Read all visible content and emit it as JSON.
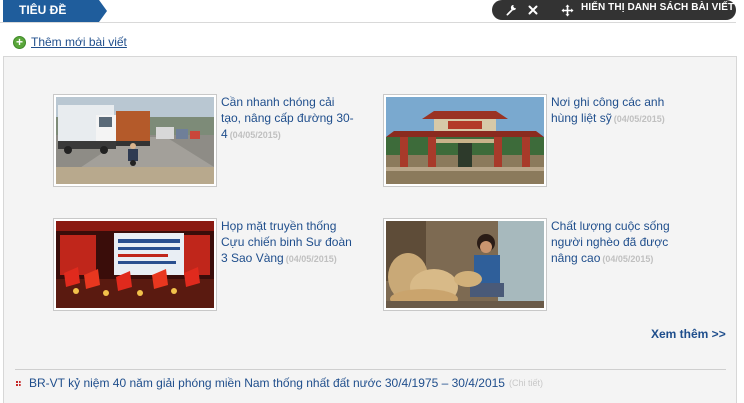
{
  "header": {
    "title": "TIÊU ĐỀ",
    "admin_list_label": "HIỂN THỊ DANH SÁCH BÀI VIẾT"
  },
  "add_post": {
    "label": "Thêm mới bài viết"
  },
  "articles": [
    {
      "title": "Cần nhanh chóng cải tạo, nâng cấp đường 30-4",
      "date": "(04/05/2015)",
      "image": "highway-trucks"
    },
    {
      "title": "Nơi ghi công các anh hùng liệt sỹ",
      "date": "(04/05/2015)",
      "image": "memorial-gate"
    },
    {
      "title": "Họp mặt truyền thống Cựu chiến binh Sư đoàn 3 Sao Vàng",
      "date": "(04/05/2015)",
      "image": "stage-flags"
    },
    {
      "title": "Chất lượng cuộc sống người nghèo đã được nâng cao",
      "date": "(04/05/2015)",
      "image": "basket-weaver"
    }
  ],
  "more_label": "Xem thêm >>",
  "bottom_article": {
    "title": "BR-VT kỷ niệm 40 năm giải phóng miền Nam thống nhất đất nước 30/4/1975 – 30/4/2015",
    "detail": "(Chi tiết)"
  },
  "colors": {
    "brand_blue": "#1f5d9c",
    "link_blue": "#1f4e8c",
    "admin_bar": "#333333",
    "add_green": "#5aa63a",
    "date_gray": "#c0c0c0",
    "bullet_red": "#c62828"
  }
}
